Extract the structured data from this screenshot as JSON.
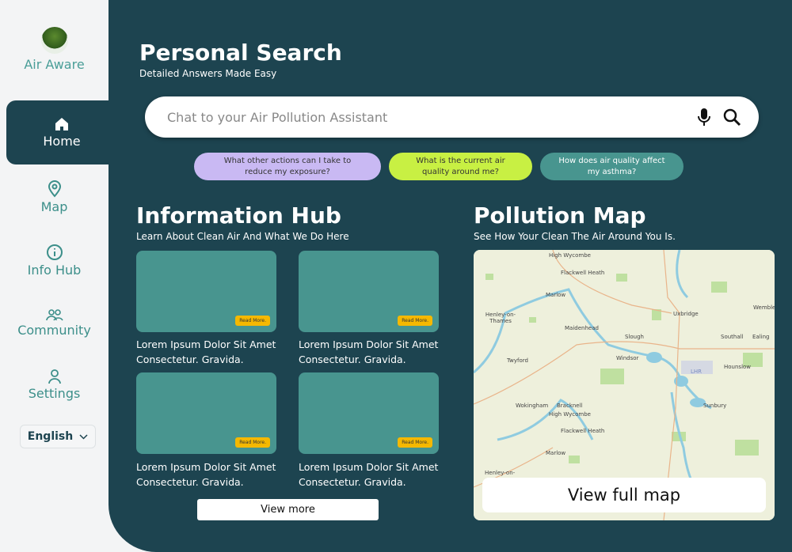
{
  "app": {
    "name": "Air Aware"
  },
  "sidebar": {
    "items": [
      {
        "label": "Home",
        "icon": "home-icon"
      },
      {
        "label": "Map",
        "icon": "map-pin-icon"
      },
      {
        "label": "Info Hub",
        "icon": "info-icon"
      },
      {
        "label": "Community",
        "icon": "people-icon"
      },
      {
        "label": "Settings",
        "icon": "user-icon"
      }
    ],
    "language": "English"
  },
  "header": {
    "title": "Personal Search",
    "subtitle": "Detailed Answers Made Easy"
  },
  "search": {
    "placeholder": "Chat to your Air Pollution Assistant"
  },
  "suggestions": [
    {
      "text": "What other actions can I take to reduce my exposure?",
      "color": "#c9b9f3"
    },
    {
      "text": "What is the current air quality around me?",
      "color": "#c8f043"
    },
    {
      "text": "How does air quality affect my asthma?",
      "color": "#48958f"
    }
  ],
  "info_hub": {
    "title": "Information Hub",
    "subtitle": "Learn About Clean Air And What We Do Here",
    "read_more": "Read More.",
    "cards": [
      {
        "text": "Lorem Ipsum Dolor Sit Amet Consectetur. Gravida."
      },
      {
        "text": "Lorem Ipsum Dolor Sit Amet Consectetur. Gravida."
      },
      {
        "text": "Lorem Ipsum Dolor Sit Amet Consectetur. Gravida."
      },
      {
        "text": "Lorem Ipsum Dolor Sit Amet Consectetur. Gravida."
      }
    ],
    "view_more": "View more"
  },
  "pollution_map": {
    "title": "Pollution Map",
    "subtitle": "See How Your Clean The Air Around You Is.",
    "view_full": "View full map",
    "places": [
      "High Wycombe",
      "Flackwell Heath",
      "Marlow",
      "Henley-on-Thames",
      "Maidenhead",
      "Slough",
      "Uxbridge",
      "Windsor",
      "Southall",
      "Ealing",
      "Wembley",
      "Hounslow",
      "Twyford",
      "Wokingham",
      "Bracknell",
      "Sunbury",
      "LHR",
      "High Wycombe",
      "Flackwell Heath",
      "Marlow",
      "Henley-on-"
    ]
  },
  "colors": {
    "dark": "#1d4450",
    "teal": "#48958f",
    "accent_yellow": "#f5b800"
  }
}
